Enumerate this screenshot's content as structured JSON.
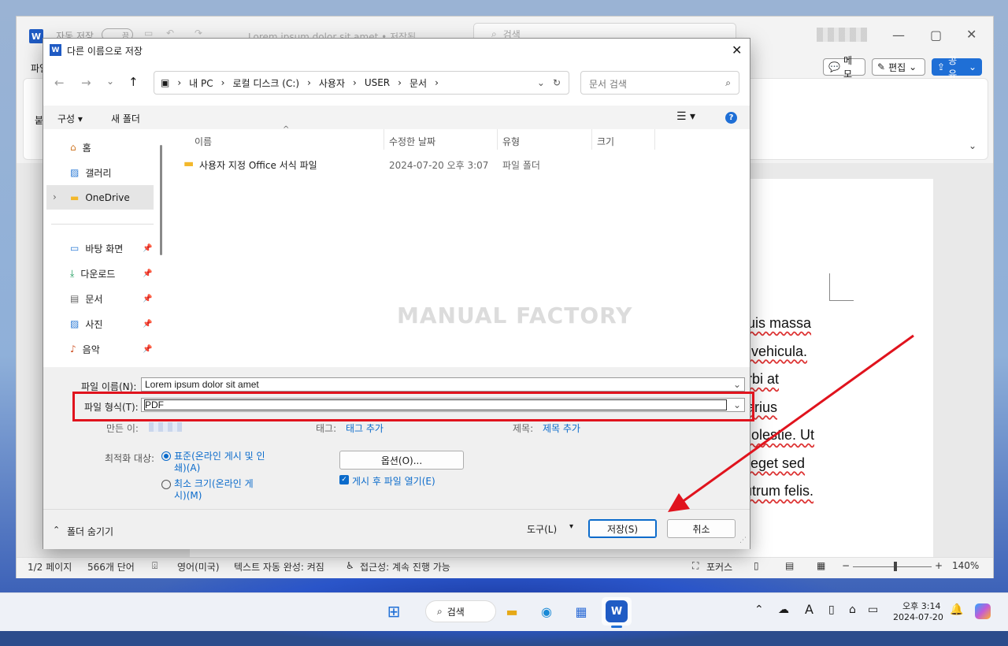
{
  "word": {
    "autosave_label": "자동 저장",
    "autosave_state": "끔",
    "doc_title": "Lorem ipsum dolor sit amet • 저장됨",
    "search_placeholder": "검색",
    "file_tab": "파일",
    "ribbon_left_char": "붙",
    "memo_btn": "메모",
    "edit_btn": "편집",
    "share_btn": "공유",
    "doc_lines": [
      "quis massa",
      "n vehicula.",
      "orbi at",
      "varius",
      "molestie. Ut",
      "s eget sed",
      "rutrum felis."
    ],
    "status": {
      "page": "1/2 페이지",
      "words": "566개 단어",
      "language": "영어(미국)",
      "autocomplete": "텍스트 자동 완성: 켜짐",
      "accessibility": "접근성: 계속 진행 가능",
      "focus": "포커스",
      "zoom": "140%"
    }
  },
  "dialog": {
    "title": "다른 이름으로 저장",
    "breadcrumb": [
      "내 PC",
      "로컬 디스크 (C:)",
      "사용자",
      "USER",
      "문서"
    ],
    "search_placeholder": "문서 검색",
    "organize": "구성",
    "new_folder": "새 폴더",
    "nav_quick": [
      {
        "label": "홈",
        "icon": "home-icon"
      },
      {
        "label": "갤러리",
        "icon": "gallery-icon"
      },
      {
        "label": "OneDrive",
        "icon": "folder-icon"
      }
    ],
    "nav_pinned": [
      {
        "label": "바탕 화면",
        "icon": "desktop-icon"
      },
      {
        "label": "다운로드",
        "icon": "download-icon"
      },
      {
        "label": "문서",
        "icon": "documents-icon"
      },
      {
        "label": "사진",
        "icon": "pictures-icon"
      },
      {
        "label": "음악",
        "icon": "music-icon"
      }
    ],
    "columns": [
      "이름",
      "수정한 날짜",
      "유형",
      "크기"
    ],
    "files": [
      {
        "name": "사용자 지정 Office 서식 파일",
        "modified": "2024-07-20 오후 3:07",
        "type": "파일 폴더",
        "size": ""
      }
    ],
    "watermark": "MANUAL FACTORY",
    "filename_label": "파일 이름(N):",
    "filename_value": "Lorem ipsum dolor sit amet",
    "filetype_label": "파일 형식(T):",
    "filetype_value": "PDF",
    "authors_label": "만든 이:",
    "tags_label": "태그:",
    "tags_value": "태그 추가",
    "title_label": "제목:",
    "title_value": "제목 추가",
    "optimize_label": "최적화 대상:",
    "optimize_standard": "표준(온라인 게시 및 인쇄)(A)",
    "optimize_min": "최소 크기(온라인 게시)(M)",
    "options_btn": "옵션(O)...",
    "open_after": "게시 후 파일 열기(E)",
    "hide_folders": "폴더 숨기기",
    "tools": "도구(L)",
    "save": "저장(S)",
    "cancel": "취소"
  },
  "taskbar": {
    "search": "검색",
    "time": "오후 3:14",
    "date": "2024-07-20"
  },
  "colors": {
    "accent": "#1f6fd6",
    "highlight": "#e0131d"
  }
}
